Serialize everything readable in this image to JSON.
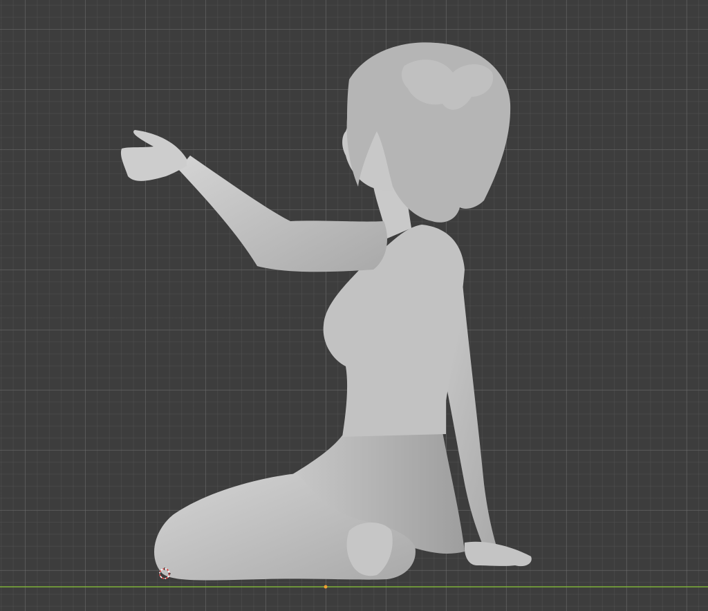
{
  "viewport": {
    "background_color": "#3d3d3d",
    "grid_color": "#5a5a5a",
    "x_axis_color": "#7fb23a",
    "model_color": "#bdbdbd",
    "cursor_icon": "3d-cursor-icon",
    "origin_icon": "origin-point-icon"
  }
}
